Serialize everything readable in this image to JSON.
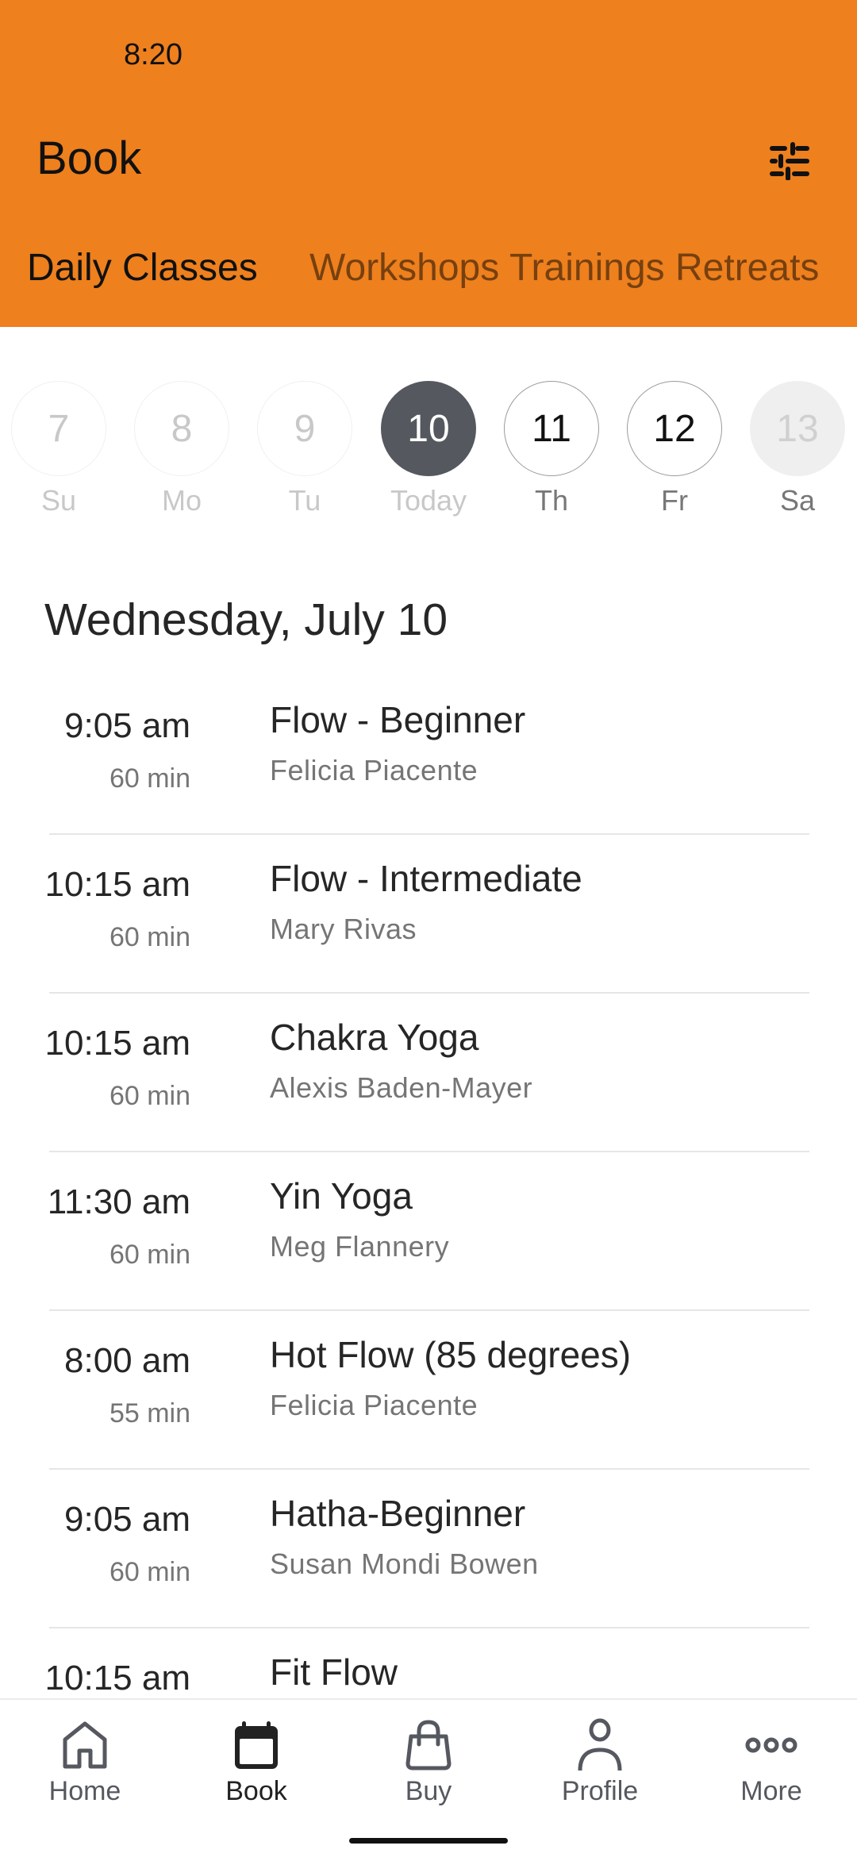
{
  "status_bar": {
    "time": "8:20"
  },
  "header": {
    "title": "Book",
    "filter_icon": "sliders-icon",
    "background_color": "#EE801E"
  },
  "tabs": [
    {
      "label": "Daily Classes",
      "active": true
    },
    {
      "label": "Workshops",
      "active": false
    },
    {
      "label": "Trainings",
      "active": false
    },
    {
      "label": "Retreats",
      "active": false
    }
  ],
  "date_strip": [
    {
      "number": "7",
      "label": "Su",
      "state": "past"
    },
    {
      "number": "8",
      "label": "Mo",
      "state": "past"
    },
    {
      "number": "9",
      "label": "Tu",
      "state": "past"
    },
    {
      "number": "10",
      "label": "Today",
      "state": "selected"
    },
    {
      "number": "11",
      "label": "Th",
      "state": "upcoming"
    },
    {
      "number": "12",
      "label": "Fr",
      "state": "upcoming"
    },
    {
      "number": "13",
      "label": "Sa",
      "state": "disabled"
    }
  ],
  "date_heading": "Wednesday, July 10",
  "classes": [
    {
      "time": "9:05 am",
      "duration": "60 min",
      "name": "Flow - Beginner",
      "instructor": "Felicia Piacente"
    },
    {
      "time": "10:15 am",
      "duration": "60 min",
      "name": "Flow - Intermediate",
      "instructor": "Mary Rivas"
    },
    {
      "time": "10:15 am",
      "duration": "60 min",
      "name": "Chakra Yoga",
      "instructor": "Alexis Baden-Mayer"
    },
    {
      "time": "11:30 am",
      "duration": "60 min",
      "name": "Yin Yoga",
      "instructor": "Meg Flannery"
    },
    {
      "time": "8:00 am",
      "duration": "55 min",
      "name": "Hot Flow (85 degrees)",
      "instructor": "Felicia Piacente"
    },
    {
      "time": "9:05 am",
      "duration": "60 min",
      "name": "Hatha-Beginner",
      "instructor": "Susan Mondi Bowen"
    },
    {
      "time": "10:15 am",
      "duration": "",
      "name": "Fit Flow",
      "instructor": ""
    }
  ],
  "bottom_nav": [
    {
      "label": "Home",
      "icon": "home-icon",
      "active": false
    },
    {
      "label": "Book",
      "icon": "calendar-icon",
      "active": true
    },
    {
      "label": "Buy",
      "icon": "shopping-bag-icon",
      "active": false
    },
    {
      "label": "Profile",
      "icon": "person-icon",
      "active": false
    },
    {
      "label": "More",
      "icon": "more-dots-icon",
      "active": false
    }
  ]
}
